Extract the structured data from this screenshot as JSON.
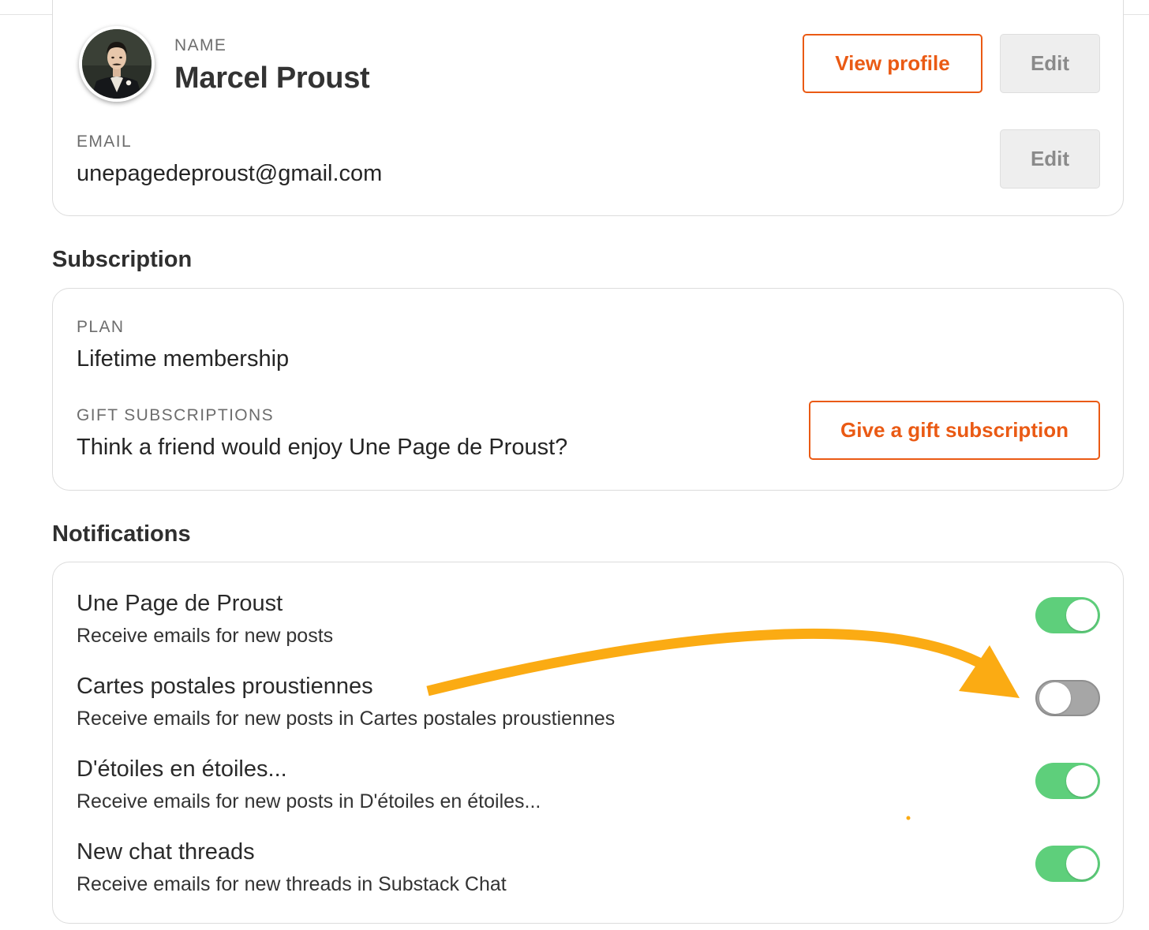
{
  "account": {
    "name_label": "NAME",
    "name": "Marcel Proust",
    "view_profile_label": "View profile",
    "edit_name_label": "Edit",
    "email_label": "EMAIL",
    "email": "unepagedeproust@gmail.com",
    "edit_email_label": "Edit"
  },
  "subscription": {
    "section_title": "Subscription",
    "plan_label": "PLAN",
    "plan": "Lifetime membership",
    "gift_label": "GIFT SUBSCRIPTIONS",
    "gift_text": "Think a friend would enjoy Une Page de Proust?",
    "gift_button_label": "Give a gift subscription"
  },
  "notifications": {
    "section_title": "Notifications",
    "items": [
      {
        "title": "Une Page de Proust",
        "subtitle": "Receive emails for new posts",
        "enabled": true
      },
      {
        "title": "Cartes postales proustiennes",
        "subtitle": "Receive emails for new posts in Cartes postales proustiennes",
        "enabled": false
      },
      {
        "title": "D'étoiles en étoiles...",
        "subtitle": "Receive emails for new posts in D'étoiles en étoiles...",
        "enabled": true
      },
      {
        "title": "New chat threads",
        "subtitle": "Receive emails for new threads in Substack Chat",
        "enabled": true
      }
    ]
  },
  "colors": {
    "accent": "#ea5a14",
    "toggle_on": "#5ecf7b",
    "toggle_off": "#a6a6a6",
    "annotation_arrow": "#fbab13"
  },
  "icons": {
    "avatar": "portrait-avatar",
    "annotation": "curved-arrow-icon"
  }
}
